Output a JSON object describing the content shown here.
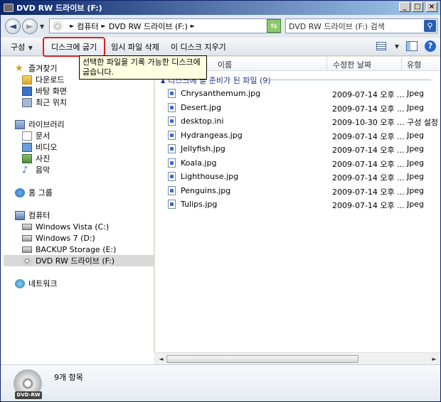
{
  "window": {
    "title": "DVD RW 드라이브 (F:)"
  },
  "address": {
    "crumbs": [
      "컴퓨터",
      "DVD RW 드라이브 (F:)"
    ],
    "search_placeholder": "DVD RW 드라이브 (F:) 검색"
  },
  "toolbar": {
    "organize": "구성",
    "burn": "디스크에 굽기",
    "delete_temp": "임시 파일 삭제",
    "erase": "이 디스크 지우기"
  },
  "tooltip": "선택한 파일을 기록 가능한 디스크에 굽습니다.",
  "nav": {
    "favorites": "즐겨찾기",
    "downloads": "다운로드",
    "desktop": "바탕 화면",
    "recent": "최근 위치",
    "libraries": "라이브러리",
    "documents": "문서",
    "videos": "비디오",
    "pictures": "사진",
    "music": "음악",
    "homegroup": "홈 그룹",
    "computer": "컴퓨터",
    "drive_c": "Windows Vista (C:)",
    "drive_d": "Windows 7 (D:)",
    "drive_e": "BACKUP Storage (E:)",
    "drive_f": "DVD RW 드라이브 (F:)",
    "network": "네트워크"
  },
  "columns": {
    "name": "이름",
    "modified": "수정한 날짜",
    "type": "유형"
  },
  "group_header": "디스크에 쓸 준비가 된 파일 (9)",
  "files": [
    {
      "name": "Chrysanthemum.jpg",
      "date": "2009-07-14 오후 ...",
      "type": "Jpeg"
    },
    {
      "name": "Desert.jpg",
      "date": "2009-07-14 오후 ...",
      "type": "Jpeg"
    },
    {
      "name": "desktop.ini",
      "date": "2009-10-30 오후 ...",
      "type": "구성 설정"
    },
    {
      "name": "Hydrangeas.jpg",
      "date": "2009-07-14 오후 ...",
      "type": "Jpeg"
    },
    {
      "name": "Jellyfish.jpg",
      "date": "2009-07-14 오후 ...",
      "type": "Jpeg"
    },
    {
      "name": "Koala.jpg",
      "date": "2009-07-14 오후 ...",
      "type": "Jpeg"
    },
    {
      "name": "Lighthouse.jpg",
      "date": "2009-07-14 오후 ...",
      "type": "Jpeg"
    },
    {
      "name": "Penguins.jpg",
      "date": "2009-07-14 오후 ...",
      "type": "Jpeg"
    },
    {
      "name": "Tulips.jpg",
      "date": "2009-07-14 오후 ...",
      "type": "Jpeg"
    }
  ],
  "status": {
    "item_count": "9개 항목",
    "drive_label": "DVD-RW"
  }
}
